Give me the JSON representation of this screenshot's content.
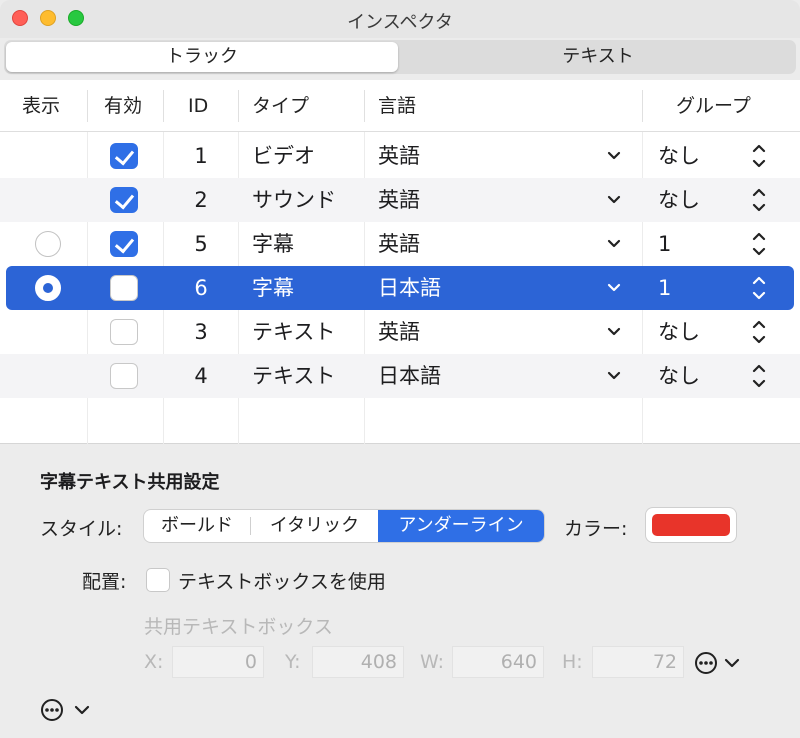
{
  "window": {
    "title": "インスペクタ"
  },
  "tabs": [
    {
      "label": "トラック"
    },
    {
      "label": "テキスト"
    }
  ],
  "table": {
    "headers": {
      "show": "表示",
      "enabled": "有効",
      "id": "ID",
      "type": "タイプ",
      "language": "言語",
      "group": "グループ"
    },
    "rows": [
      {
        "show": "none",
        "enabled": true,
        "id": "1",
        "type": "ビデオ",
        "language": "英語",
        "group": "なし"
      },
      {
        "show": "none",
        "enabled": true,
        "id": "2",
        "type": "サウンド",
        "language": "英語",
        "group": "なし"
      },
      {
        "show": "off",
        "enabled": true,
        "id": "5",
        "type": "字幕",
        "language": "英語",
        "group": "1"
      },
      {
        "show": "on",
        "enabled": false,
        "id": "6",
        "type": "字幕",
        "language": "日本語",
        "group": "1",
        "selected": true
      },
      {
        "show": "none",
        "enabled": false,
        "id": "3",
        "type": "テキスト",
        "language": "英語",
        "group": "なし"
      },
      {
        "show": "none",
        "enabled": false,
        "id": "4",
        "type": "テキスト",
        "language": "日本語",
        "group": "なし"
      }
    ]
  },
  "settings": {
    "title": "字幕テキスト共用設定",
    "style_label": "スタイル:",
    "style_options": [
      "ボールド",
      "イタリック",
      "アンダーライン"
    ],
    "style_selected": "アンダーライン",
    "color_label": "カラー:",
    "color_value": "#e8342a",
    "placement_label": "配置:",
    "use_textbox_label": "テキストボックスを使用",
    "use_textbox_checked": false,
    "shared_box_label": "共用テキストボックス",
    "x_label": "X:",
    "x_value": "0",
    "y_label": "Y:",
    "y_value": "408",
    "w_label": "W:",
    "w_value": "640",
    "h_label": "H:",
    "h_value": "72"
  },
  "colors": {
    "accent": "#2f6fe6",
    "selection": "#2c64d6"
  }
}
